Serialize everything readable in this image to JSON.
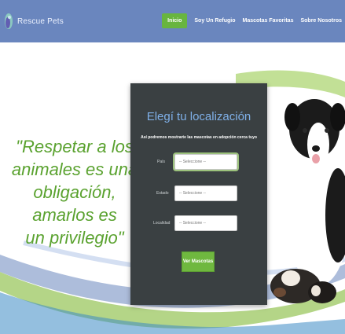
{
  "brand": {
    "name": "Rescue Pets"
  },
  "nav": {
    "items": [
      {
        "label": "Inicio",
        "active": true
      },
      {
        "label": "Soy Un Refugio",
        "active": false
      },
      {
        "label": "Mascotas Favoritas",
        "active": false
      },
      {
        "label": "Sobre Nosotros",
        "active": false
      }
    ]
  },
  "hero": {
    "quote_lines": [
      "\"Respetar a los",
      "animales es una",
      "obligación, amarlos es",
      "un privilegio\""
    ]
  },
  "form": {
    "title": "Elegí tu localización",
    "subtitle": "Así podremos mostrarte las mascotas en adopción cerca tuyo",
    "fields": [
      {
        "label": "País",
        "placeholder": "-- Seleccione --"
      },
      {
        "label": "Estado",
        "placeholder": "-- Seleccione --"
      },
      {
        "label": "Localidad",
        "placeholder": "-- Seleccione --"
      }
    ],
    "submit_label": "Ver Mascotas"
  },
  "colors": {
    "navbar": "#6a86be",
    "accent_green": "#68b53f",
    "panel": "#3a4042",
    "title_blue": "#7fb0e8",
    "quote_green": "#5aa22f"
  }
}
